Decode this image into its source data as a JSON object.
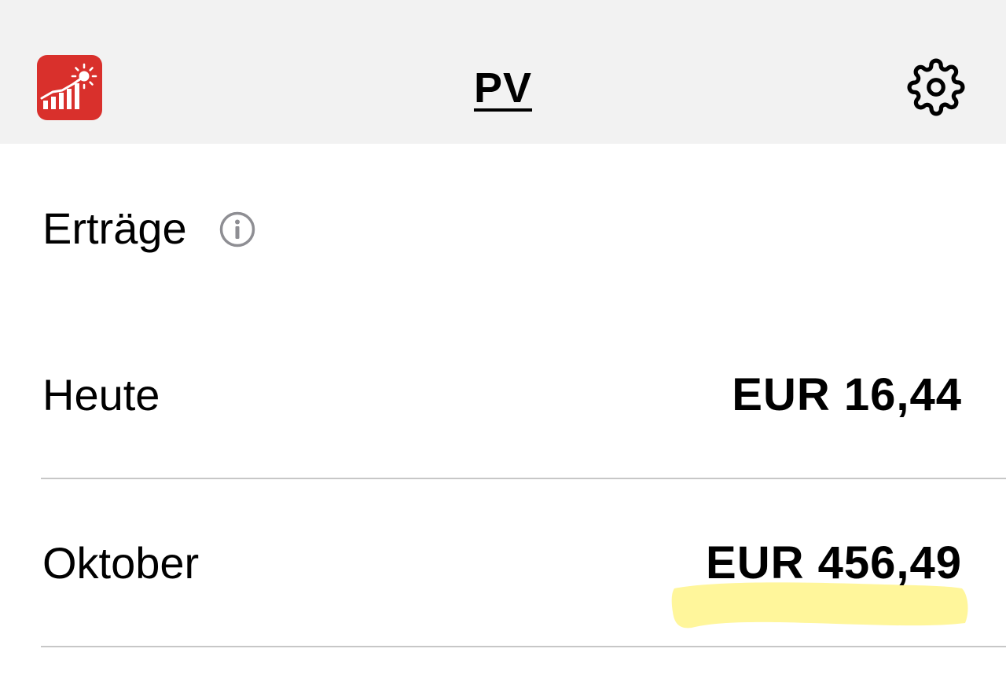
{
  "header": {
    "title": "PV",
    "app_icon": "solar-chart-app-icon",
    "settings_icon": "gear-icon",
    "icon_color": "#d9302c"
  },
  "section": {
    "title": "Erträge",
    "info_icon": "info-icon"
  },
  "rows": [
    {
      "label": "Heute",
      "value": "EUR 16,44"
    },
    {
      "label": "Oktober",
      "value": "EUR 456,49"
    }
  ],
  "highlight_color": "#fff58a"
}
